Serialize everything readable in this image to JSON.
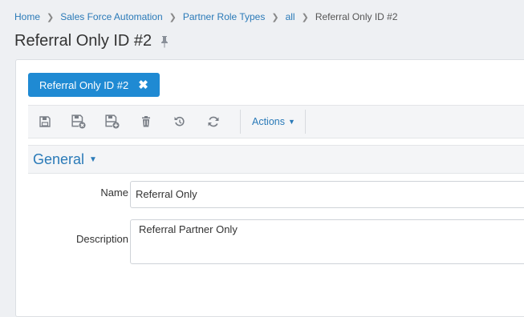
{
  "breadcrumb": {
    "items": [
      "Home",
      "Sales Force Automation",
      "Partner Role Types",
      "all"
    ],
    "current": "Referral Only ID #2"
  },
  "page": {
    "title": "Referral Only ID #2"
  },
  "record_tab": {
    "label": "Referral Only ID #2"
  },
  "toolbar": {
    "actions_label": "Actions"
  },
  "section": {
    "title": "General"
  },
  "form": {
    "name_label": "Name",
    "name_value": "Referral Only",
    "description_label": "Description",
    "description_value": "Referral Partner Only"
  },
  "colors": {
    "accent": "#1f8ad3",
    "link": "#2a7ab8",
    "background": "#eef0f3"
  }
}
